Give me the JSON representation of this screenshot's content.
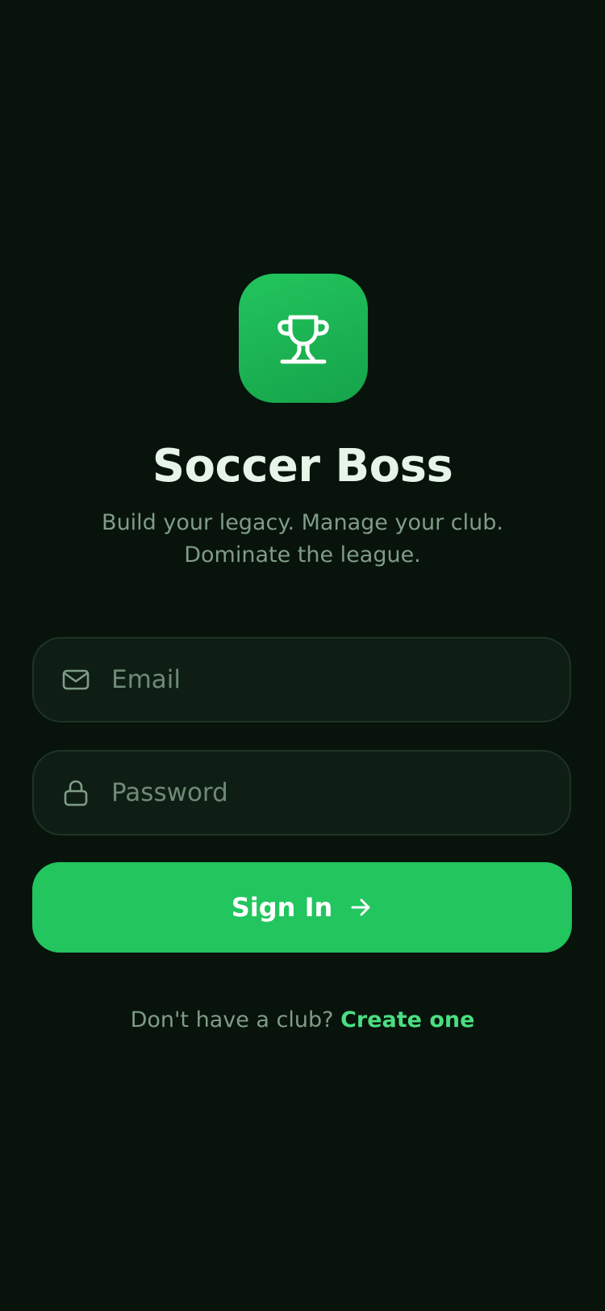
{
  "app": {
    "icon": "trophy-icon",
    "title": "Soccer Boss",
    "subtitle_line1": "Build your legacy. Manage your club.",
    "subtitle_line2": "Dominate the league."
  },
  "form": {
    "email": {
      "icon": "mail-icon",
      "placeholder": "Email",
      "value": ""
    },
    "password": {
      "icon": "lock-icon",
      "placeholder": "Password",
      "value": ""
    },
    "signin": {
      "label": "Sign In",
      "icon": "arrow-right-icon"
    }
  },
  "footer": {
    "prompt": "Don't have a club?",
    "link": "Create one"
  },
  "colors": {
    "background": "#08130c",
    "accent": "#22c55e",
    "link": "#4ade80",
    "title": "#e6f5e8",
    "muted": "#7f9c86",
    "field_bg": "#0e1e14",
    "field_border": "#1d3324"
  }
}
